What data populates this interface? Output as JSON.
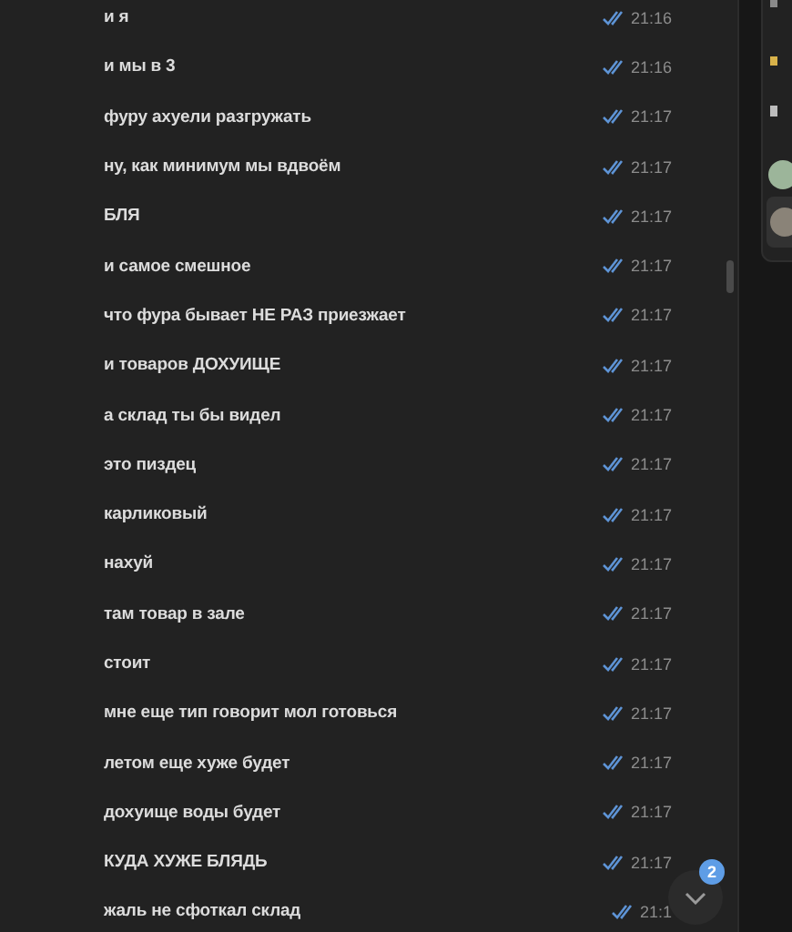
{
  "messages": [
    {
      "text": "и я",
      "time": "21:16",
      "read": true
    },
    {
      "text": "и мы в 3",
      "time": "21:16",
      "read": true
    },
    {
      "text": "фуру ахуели разгружать",
      "time": "21:17",
      "read": true
    },
    {
      "text": "ну, как минимум мы вдвоём",
      "time": "21:17",
      "read": true
    },
    {
      "text": "БЛЯ",
      "time": "21:17",
      "read": true
    },
    {
      "text": "и самое смешное",
      "time": "21:17",
      "read": true
    },
    {
      "text": "что фура бывает НЕ РАЗ приезжает",
      "time": "21:17",
      "read": true
    },
    {
      "text": "и товаров ДОХУИЩЕ",
      "time": "21:17",
      "read": true
    },
    {
      "text": "а склад ты бы видел",
      "time": "21:17",
      "read": true
    },
    {
      "text": "это пиздец",
      "time": "21:17",
      "read": true
    },
    {
      "text": "карликовый",
      "time": "21:17",
      "read": true
    },
    {
      "text": "нахуй",
      "time": "21:17",
      "read": true
    },
    {
      "text": "там товар в зале",
      "time": "21:17",
      "read": true
    },
    {
      "text": "стоит",
      "time": "21:17",
      "read": true
    },
    {
      "text": "мне еще тип говорит мол готовься",
      "time": "21:17",
      "read": true
    },
    {
      "text": "летом еще хуже будет",
      "time": "21:17",
      "read": true
    },
    {
      "text": "дохуище воды будет",
      "time": "21:17",
      "read": true
    },
    {
      "text": "КУДА ХУЖЕ БЛЯДЬ",
      "time": "21:17",
      "read": true
    },
    {
      "text": "жаль не сфоткал склад",
      "time": "21:1",
      "read": true
    }
  ],
  "scroll_button": {
    "badge": "2"
  }
}
